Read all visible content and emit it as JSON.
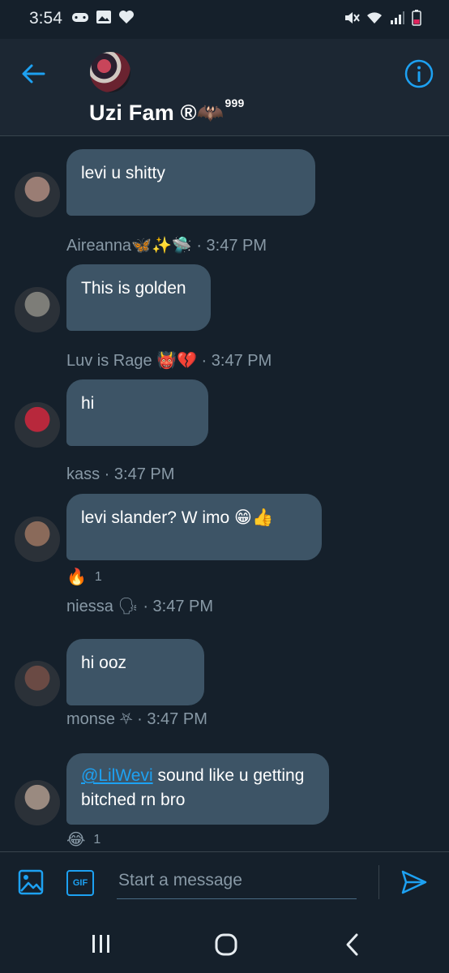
{
  "status_bar": {
    "time": "3:54",
    "left_icons": [
      "game-controller-icon",
      "image-icon",
      "heart-icon"
    ],
    "right_icons": [
      "mute-icon",
      "wifi-icon",
      "signal-icon",
      "battery-icon"
    ]
  },
  "header": {
    "title": "Uzi Fam ®🦇",
    "title_suffix": "999",
    "back_icon": "arrow-left-icon",
    "info_icon": "info-icon"
  },
  "messages": [
    {
      "text": "levi u shitty",
      "sender": "Aireanna🦋✨🛸",
      "time": "3:47 PM",
      "avatar_color": "#9a7d74"
    },
    {
      "text": "This is golden",
      "sender": "Luv is Rage 👹💔",
      "time": "3:47 PM",
      "avatar_color": "#7d7d78"
    },
    {
      "text": "hi",
      "sender": "kass",
      "time": "3:47 PM",
      "avatar_color": "#b8283c"
    },
    {
      "text": "levi slander? W imo 😁👍",
      "sender": "niessa 🗣",
      "time": "3:47 PM",
      "reaction": {
        "emoji": "🔥",
        "count": "1"
      },
      "avatar_color": "#8a6a5a"
    },
    {
      "text": "hi ooz",
      "sender": "monse ⛧",
      "time": "3:47 PM",
      "avatar_color": "#6a4a44"
    },
    {
      "mention": "@LilWevi",
      "text": " sound like u getting bitched rn bro",
      "reaction": {
        "emoji": "😂",
        "count": "1"
      },
      "avatar_color": "#9a8a80"
    }
  ],
  "composer": {
    "placeholder": "Start a message",
    "gif_label": "GIF",
    "media_icon": "image-icon",
    "send_icon": "send-icon"
  },
  "nav_bar": {
    "icons": [
      "recent-apps-icon",
      "home-icon",
      "back-icon"
    ]
  },
  "colors": {
    "background": "#15202b",
    "header": "#1c2733",
    "bubble": "#3d5466",
    "accent": "#1da1f2",
    "meta_text": "#8899a6"
  }
}
